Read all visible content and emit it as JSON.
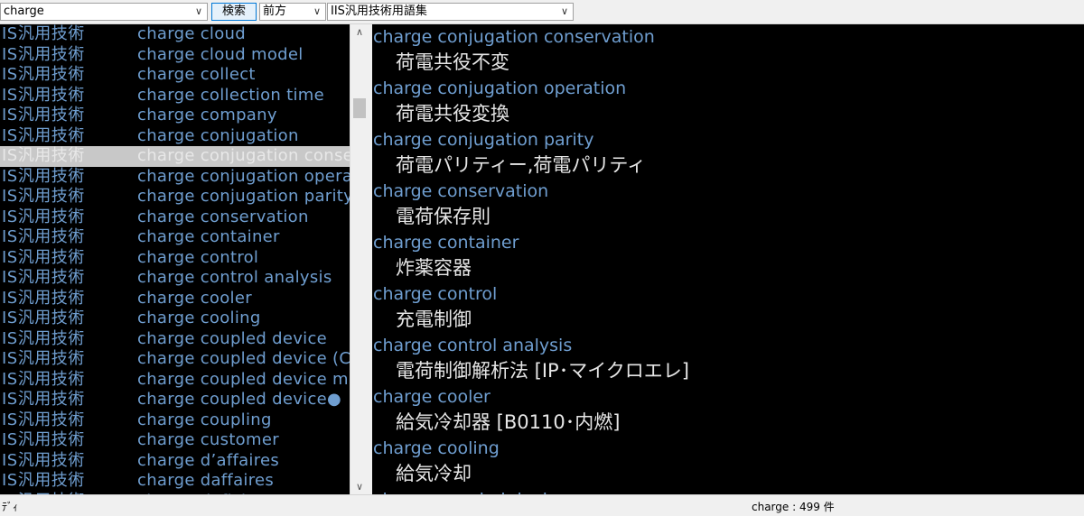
{
  "toolbar": {
    "search_value": "charge",
    "search_button_label": "検索",
    "match_mode": "前方",
    "dictionary": "IIS汎用技術用語集"
  },
  "list": {
    "rows": [
      {
        "dict": "IS汎用技術",
        "term": "charge cloud"
      },
      {
        "dict": "IS汎用技術",
        "term": "charge cloud model"
      },
      {
        "dict": "IS汎用技術",
        "term": "charge collect"
      },
      {
        "dict": "IS汎用技術",
        "term": "charge collection time"
      },
      {
        "dict": "IS汎用技術",
        "term": "charge company"
      },
      {
        "dict": "IS汎用技術",
        "term": "charge conjugation"
      },
      {
        "dict": "IS汎用技術",
        "term": "charge conjugation conservation",
        "selected": true
      },
      {
        "dict": "IS汎用技術",
        "term": "charge conjugation opera"
      },
      {
        "dict": "IS汎用技術",
        "term": "charge conjugation parity"
      },
      {
        "dict": "IS汎用技術",
        "term": "charge conservation"
      },
      {
        "dict": "IS汎用技術",
        "term": "charge container"
      },
      {
        "dict": "IS汎用技術",
        "term": "charge control"
      },
      {
        "dict": "IS汎用技術",
        "term": "charge control analysis"
      },
      {
        "dict": "IS汎用技術",
        "term": "charge cooler"
      },
      {
        "dict": "IS汎用技術",
        "term": "charge cooling"
      },
      {
        "dict": "IS汎用技術",
        "term": "charge coupled device"
      },
      {
        "dict": "IS汎用技術",
        "term": "charge coupled device (C"
      },
      {
        "dict": "IS汎用技術",
        "term": "charge coupled device m"
      },
      {
        "dict": "IS汎用技術",
        "term": "charge coupled device●"
      },
      {
        "dict": "IS汎用技術",
        "term": "charge coupling"
      },
      {
        "dict": "IS汎用技術",
        "term": "charge customer"
      },
      {
        "dict": "IS汎用技術",
        "term": "charge d’affaires"
      },
      {
        "dict": "IS汎用技術",
        "term": "charge daffaires"
      },
      {
        "dict": "IS汎用技術",
        "term": "charge deficient"
      }
    ]
  },
  "entries": [
    {
      "term": "charge conjugation conservation",
      "def": "荷電共役不変"
    },
    {
      "term": "charge conjugation operation",
      "def": "荷電共役変換"
    },
    {
      "term": "charge conjugation parity",
      "def": "荷電パリティー,荷電パリティ"
    },
    {
      "term": "charge conservation",
      "def": "電荷保存則"
    },
    {
      "term": "charge container",
      "def": "炸薬容器"
    },
    {
      "term": "charge control",
      "def": "充電制御"
    },
    {
      "term": "charge control analysis",
      "def": "電荷制御解析法 [IP･マイクロエレ]"
    },
    {
      "term": "charge cooler",
      "def": "給気冷却器 [B0110･内燃]"
    },
    {
      "term": "charge cooling",
      "def": "給気冷却"
    },
    {
      "term": "charge coupled device",
      "def": ""
    }
  ],
  "status": {
    "left": "ﾃﾞｨ",
    "right": "charge : 499 件"
  },
  "colors": {
    "term": "#6f9ed0",
    "definition": "#e6e6e6",
    "background": "#000000",
    "selection": "#c8c8c8"
  }
}
